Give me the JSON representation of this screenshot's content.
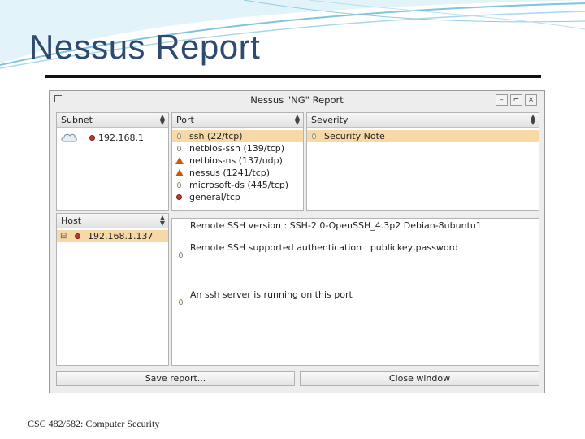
{
  "slide": {
    "title": "Nessus Report",
    "footer": "CSC 482/582: Computer Security"
  },
  "window": {
    "title": "Nessus \"NG\" Report",
    "buttons": [
      "–",
      "⌐",
      "×"
    ]
  },
  "subnet": {
    "header": "Subnet",
    "items": [
      {
        "label": "192.168.1",
        "icon": "red-dot-icon"
      }
    ]
  },
  "port": {
    "header": "Port",
    "items": [
      {
        "label": "ssh (22/tcp)",
        "icon": "note-icon",
        "selected": true
      },
      {
        "label": "netbios-ssn (139/tcp)",
        "icon": "note-icon"
      },
      {
        "label": "netbios-ns (137/udp)",
        "icon": "warning-icon"
      },
      {
        "label": "nessus (1241/tcp)",
        "icon": "warning-icon"
      },
      {
        "label": "microsoft-ds (445/tcp)",
        "icon": "note-icon"
      },
      {
        "label": "general/tcp",
        "icon": "red-dot-icon"
      }
    ]
  },
  "severity": {
    "header": "Severity",
    "items": [
      {
        "label": "Security Note",
        "icon": "note-icon",
        "selected": true
      }
    ]
  },
  "host": {
    "header": "Host",
    "items": [
      {
        "label": "192.168.1.137",
        "icon": "red-dot-icon",
        "selected": true
      }
    ]
  },
  "details": {
    "lines": [
      "Remote SSH version : SSH-2.0-OpenSSH_4.3p2 Debian-8ubuntu1",
      "Remote SSH supported authentication : publickey,password",
      "An ssh server is running on this port"
    ]
  },
  "actions": {
    "save_label": "Save report...",
    "close_label": "Close window"
  },
  "colors": {
    "title": "#2e4a6f",
    "selection": "#f7d9a8",
    "swoosh": "#7fc4e0"
  }
}
